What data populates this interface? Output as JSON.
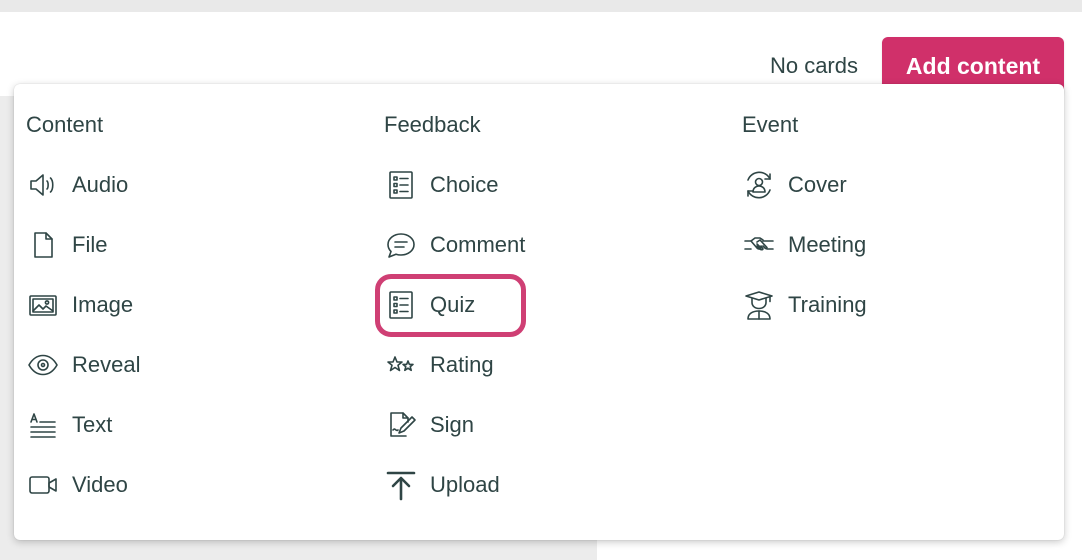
{
  "header": {
    "no_cards": "No cards",
    "add_content": "Add content",
    "accent": "#d0306a"
  },
  "menu": {
    "content": {
      "heading": "Content",
      "items": [
        {
          "label": "Audio",
          "icon": "speaker-icon"
        },
        {
          "label": "File",
          "icon": "file-icon"
        },
        {
          "label": "Image",
          "icon": "image-icon"
        },
        {
          "label": "Reveal",
          "icon": "eye-icon"
        },
        {
          "label": "Text",
          "icon": "text-icon"
        },
        {
          "label": "Video",
          "icon": "video-icon"
        }
      ]
    },
    "feedback": {
      "heading": "Feedback",
      "items": [
        {
          "label": "Choice",
          "icon": "checklist-icon"
        },
        {
          "label": "Comment",
          "icon": "speech-bubble-icon"
        },
        {
          "label": "Quiz",
          "icon": "checklist-icon"
        },
        {
          "label": "Rating",
          "icon": "stars-icon"
        },
        {
          "label": "Sign",
          "icon": "signature-icon"
        },
        {
          "label": "Upload",
          "icon": "upload-icon"
        }
      ]
    },
    "event": {
      "heading": "Event",
      "items": [
        {
          "label": "Cover",
          "icon": "cover-user-icon"
        },
        {
          "label": "Meeting",
          "icon": "handshake-icon"
        },
        {
          "label": "Training",
          "icon": "graduate-icon"
        }
      ]
    },
    "highlighted_item": "Quiz",
    "highlight_color": "#cf3f74"
  }
}
